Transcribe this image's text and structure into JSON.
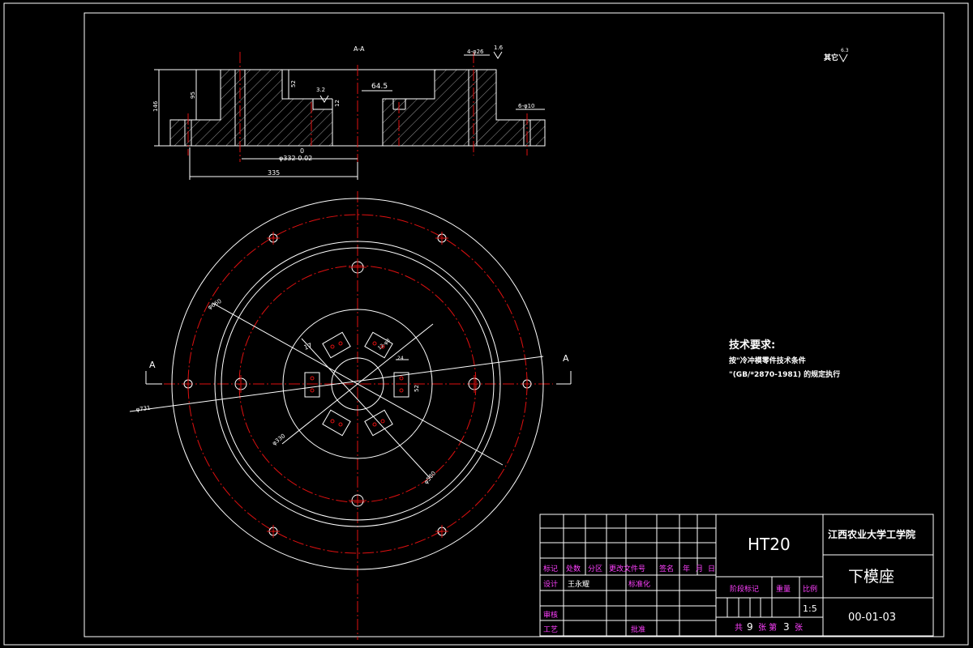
{
  "section": {
    "title": "A-A",
    "dims": {
      "d1": "4-φ26",
      "d2": "1.6",
      "d3": "52",
      "d4": "3.2",
      "d5": "64.5",
      "d6": "95",
      "d7": "146",
      "d8": "6-φ10",
      "d9": "0",
      "d10": "φ332-0.02",
      "d11": "335",
      "d12": "12"
    },
    "finish": "其它",
    "finish_value": "6.3"
  },
  "plan": {
    "section_mark_left": "A",
    "section_mark_right": "A",
    "dims": {
      "dia_a": "φ660",
      "dia_b": "φ731",
      "dia_c": "φ330",
      "dia_d": "φ580",
      "d17": "17",
      "d12b": "12-φ8",
      "d24": "24",
      "d52": "52"
    }
  },
  "notes": {
    "title": "技术要求:",
    "line1": "按\"冷冲模零件技术条件",
    "line2": "\"(GB/*2870-1981) 的规定执行"
  },
  "title_block": {
    "material": "HT20",
    "school": "江西农业大学工学院",
    "part_name": "下模座",
    "drawing_no": "00-01-03",
    "hdr_mark": "标记",
    "hdr_count": "处数",
    "hdr_zone": "分区",
    "hdr_doc": "更改文件号",
    "hdr_sign": "签名",
    "hdr_year": "年",
    "hdr_month": "月",
    "hdr_day": "日",
    "design": "设计",
    "designer": "王永耀",
    "standard": "标准化",
    "stage": "阶段标记",
    "weight": "重量",
    "scale": "比例",
    "scale_value": "1:5",
    "check": "审核",
    "process": "工艺",
    "approve": "批准",
    "sheets_prefix": "共",
    "sheets_total": "9",
    "sheets_mid": "张 第",
    "sheet_no": "3",
    "sheets_suffix": "张"
  }
}
